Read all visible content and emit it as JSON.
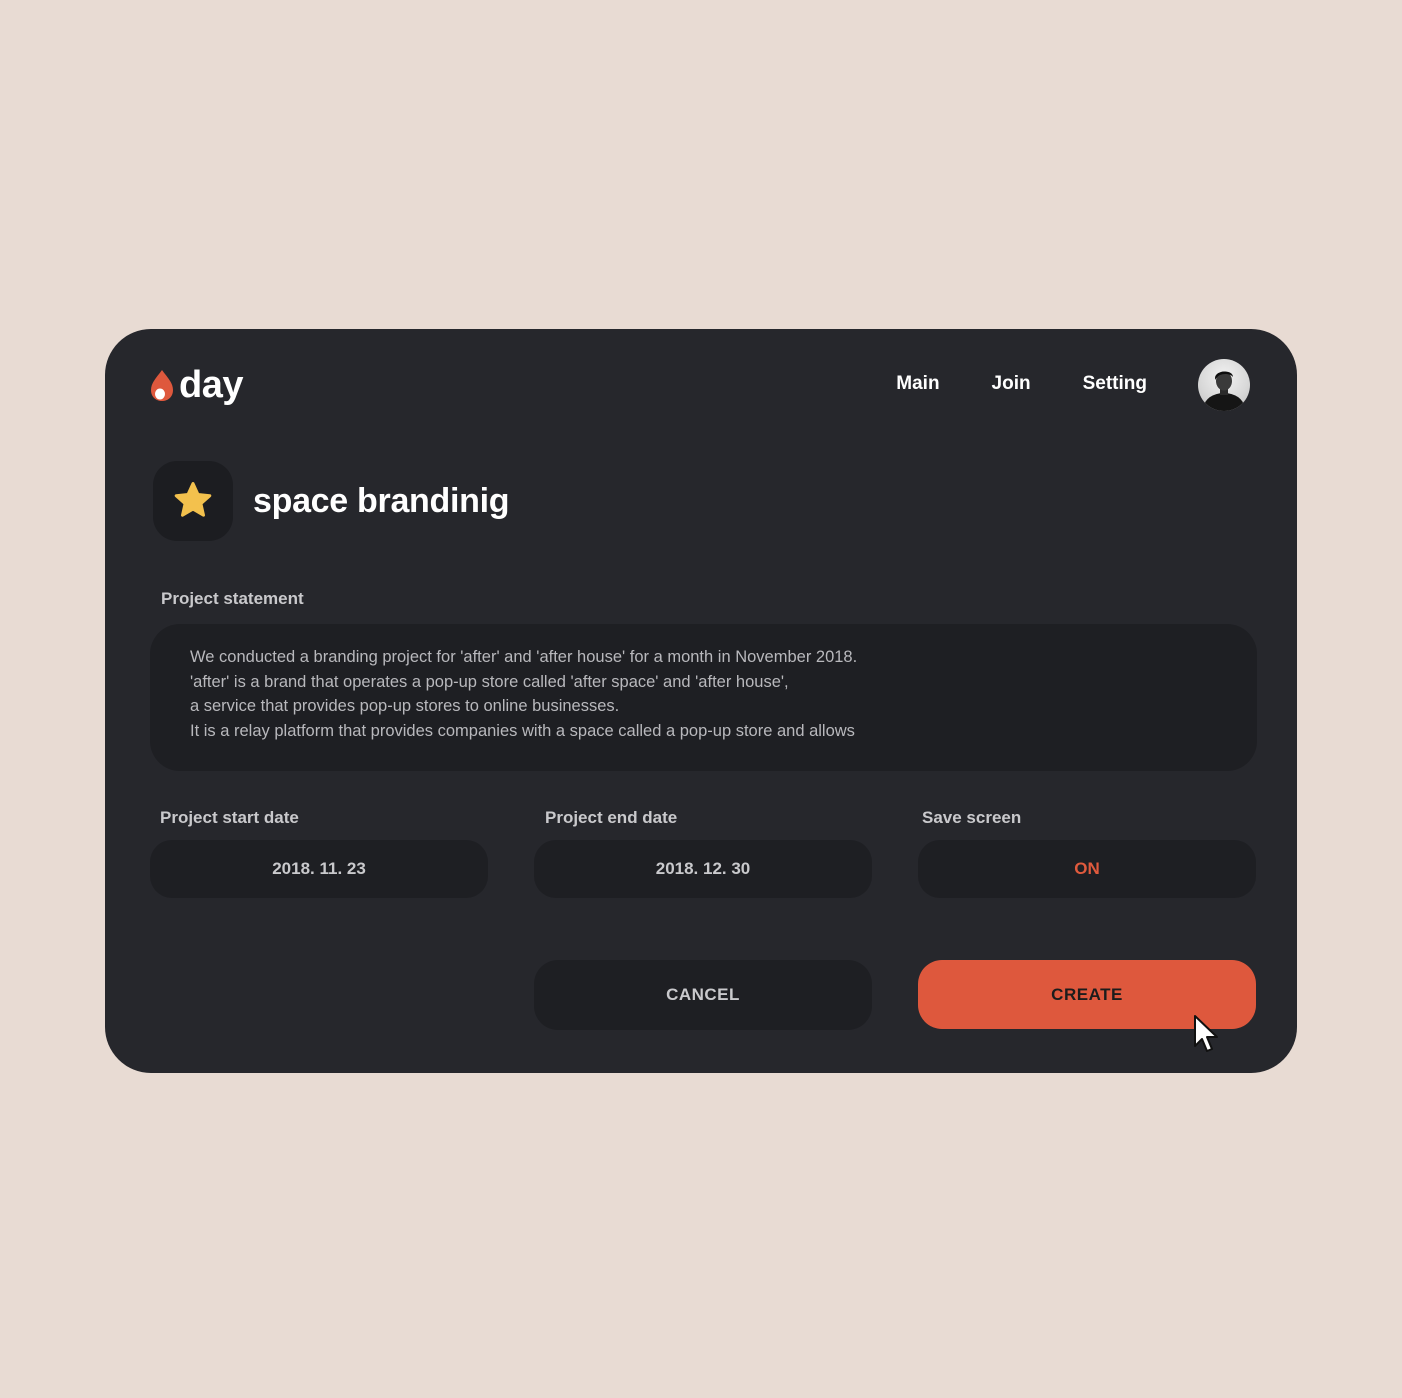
{
  "brand": {
    "name": "day",
    "accent_color": "#de583d"
  },
  "nav": {
    "items": [
      {
        "label": "Main"
      },
      {
        "label": "Join"
      },
      {
        "label": "Setting"
      }
    ],
    "avatar_icon": "user-avatar-icon"
  },
  "project": {
    "icon": "star-icon",
    "title": "space brandinig"
  },
  "statement": {
    "label": "Project statement",
    "lines": [
      "We conducted a branding project for 'after' and 'after house' for a month in November 2018.",
      "'after' is a brand that operates a pop-up store called 'after space' and 'after house',",
      "a service that provides pop-up stores to online businesses.",
      "It is a relay platform that provides companies with a space called a pop-up store and allows"
    ]
  },
  "fields": {
    "start": {
      "label": "Project start date",
      "value": "2018. 11. 23"
    },
    "end": {
      "label": "Project end date",
      "value": "2018. 12. 30"
    },
    "save": {
      "label": "Save screen",
      "value": "ON"
    }
  },
  "actions": {
    "cancel_label": "CANCEL",
    "create_label": "CREATE"
  }
}
